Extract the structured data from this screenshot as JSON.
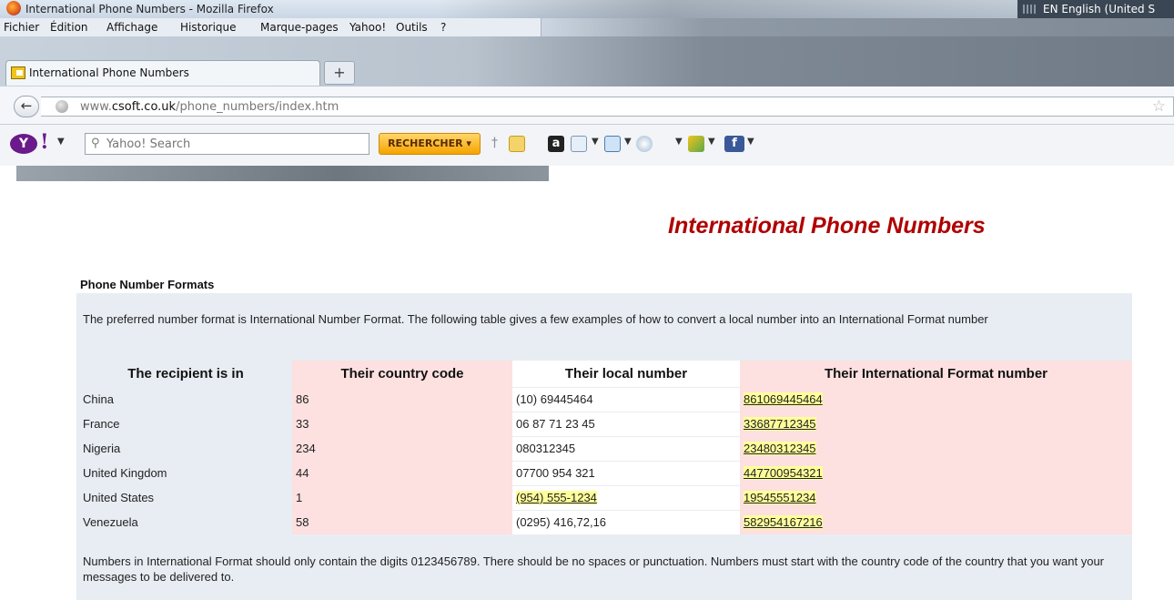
{
  "window": {
    "title": "International Phone Numbers - Mozilla Firefox",
    "language": "EN English (United S"
  },
  "menu": {
    "items": [
      "Fichier",
      "Édition",
      "Affichage",
      "Historique",
      "Marque-pages",
      "Yahoo!",
      "Outils",
      "?"
    ]
  },
  "tab": {
    "label": "International Phone Numbers",
    "new_tab": "+"
  },
  "nav": {
    "url_prefix": "www.",
    "url_domain": "csoft.co.uk",
    "url_path": "/phone_numbers/index.htm"
  },
  "yahoo": {
    "logo": "Y",
    "excl": "!",
    "search_placeholder": "Yahoo! Search",
    "search_button": "RECHERCHER ▾"
  },
  "page": {
    "title": "International Phone Numbers",
    "section_title": "Phone Number Formats",
    "intro": "The preferred number format is International Number Format. The following table gives a few examples of how to convert a local number into an International Format number",
    "table": {
      "headers": [
        "The recipient is in",
        "Their country code",
        "Their local number",
        "Their International Format number"
      ],
      "rows": [
        {
          "country": "China",
          "code": "86",
          "local": "(10) 69445464",
          "intl": "861069445464"
        },
        {
          "country": "France",
          "code": "33",
          "local": "06 87 71 23 45",
          "intl": "33687712345"
        },
        {
          "country": "Nigeria",
          "code": "234",
          "local": "080312345",
          "intl": "23480312345"
        },
        {
          "country": "United Kingdom",
          "code": "44",
          "local": "07700 954 321",
          "intl": "447700954321"
        },
        {
          "country": "United States",
          "code": "1",
          "local": "(954) 555-1234",
          "intl": "19545551234"
        },
        {
          "country": "Venezuela",
          "code": "58",
          "local": "(0295) 416,72,16",
          "intl": "582954167216"
        }
      ]
    },
    "footer": "Numbers in International Format should only contain the digits 0123456789. There should be no spaces or punctuation. Numbers must start with the country code of the country that you want your messages to be delivered to."
  },
  "colors": {
    "title_red": "#b00000",
    "pink": "#fde0e0",
    "highlight": "#ffff9a",
    "box": "#e8edf3"
  }
}
